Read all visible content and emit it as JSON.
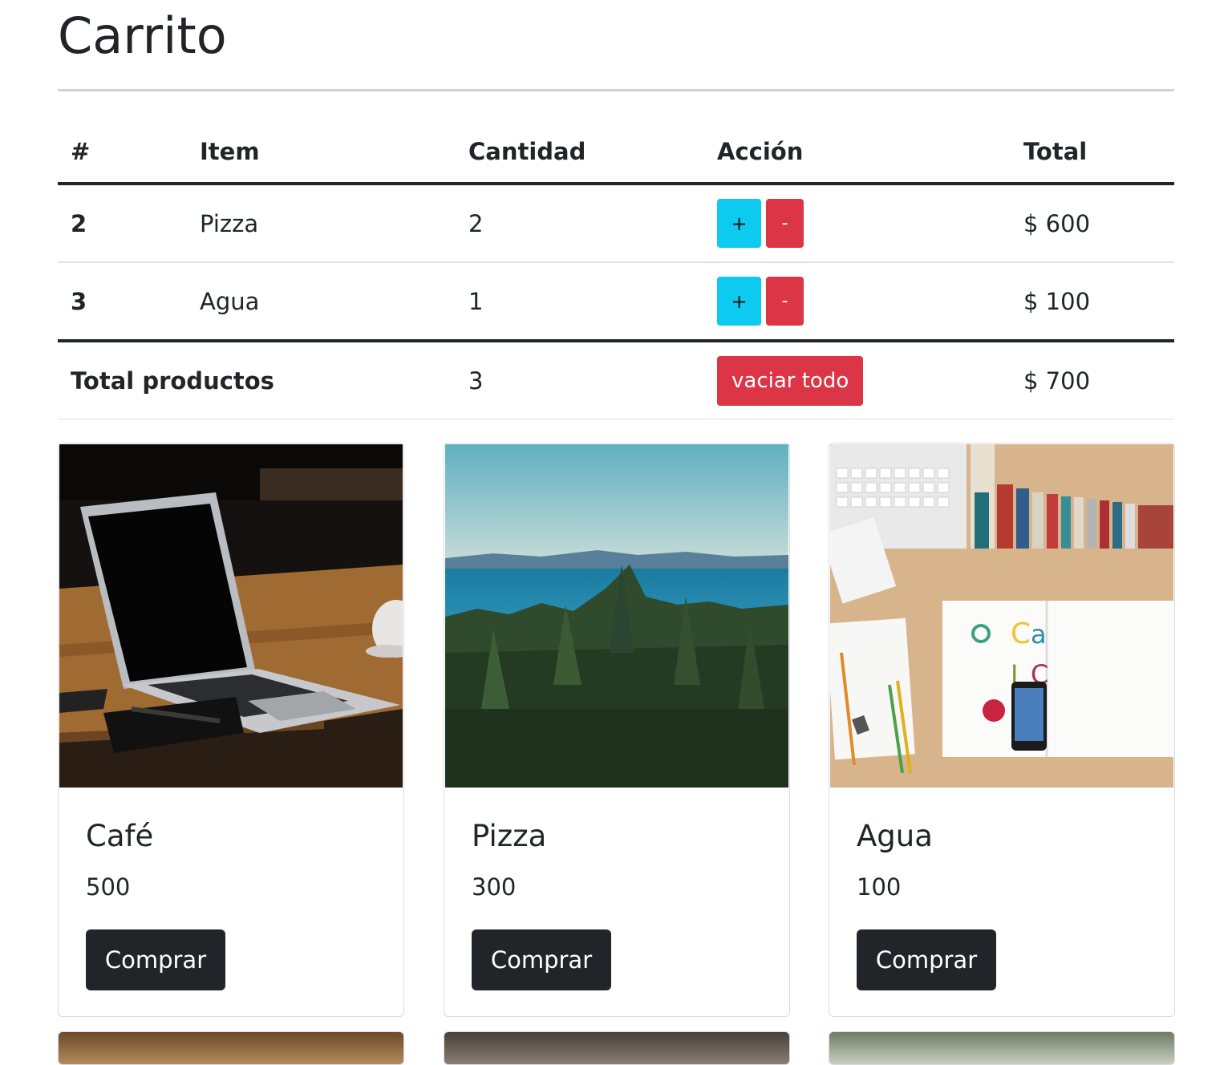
{
  "title": "Carrito",
  "table": {
    "headers": [
      "#",
      "Item",
      "Cantidad",
      "Acción",
      "Total"
    ],
    "rows": [
      {
        "id": "2",
        "item": "Pizza",
        "qty": "2",
        "plus": "+",
        "minus": "-",
        "total": "$ 600"
      },
      {
        "id": "3",
        "item": "Agua",
        "qty": "1",
        "plus": "+",
        "minus": "-",
        "total": "$ 100"
      }
    ],
    "footer": {
      "label": "Total productos",
      "qty": "3",
      "clear": "vaciar todo",
      "total": "$ 700"
    }
  },
  "products": [
    {
      "name": "Café",
      "price": "500",
      "button": "Comprar",
      "image": "laptop-on-wooden-table-photo"
    },
    {
      "name": "Pizza",
      "price": "300",
      "button": "Comprar",
      "image": "forest-and-sea-landscape-photo"
    },
    {
      "name": "Agua",
      "price": "100",
      "button": "Comprar",
      "image": "desk-with-books-and-phone-photo"
    }
  ],
  "colors": {
    "info": "#0dcaf0",
    "danger": "#dc3545",
    "dark": "#212529",
    "text": "#212529"
  }
}
